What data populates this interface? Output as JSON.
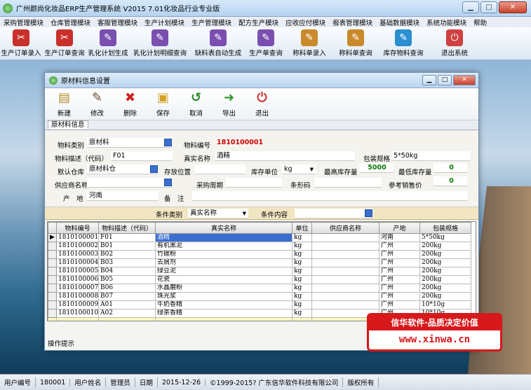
{
  "window": {
    "title": "广州颜尚化妆品ERP生产管理系统  V2015  7.01化妆品行业专业版",
    "min": "▁",
    "max": "□",
    "close": "✕"
  },
  "menu": [
    "采购管理模块",
    "仓库管理模块",
    "客服管理模块",
    "生产计划模块",
    "生产管理模块",
    "配方生产模块",
    "应收应付模块",
    "报表管理模块",
    "基础数据模块",
    "系统功能模块",
    "帮助"
  ],
  "toolbar": [
    {
      "label": "生产订单录入",
      "icon": "pdf-icon",
      "color": "#c9302c"
    },
    {
      "label": "生产订单查询",
      "icon": "pdf-icon",
      "color": "#c9302c"
    },
    {
      "label": "乳化计划生成",
      "icon": "pen-icon",
      "color": "#7a4fb0"
    },
    {
      "label": "乳化计划明细查询",
      "icon": "document-icon",
      "color": "#7a4fb0"
    },
    {
      "label": "缺料表自动生成",
      "icon": "document-icon",
      "color": "#7a4fb0"
    },
    {
      "label": "生产单查询",
      "icon": "document-icon",
      "color": "#7a4fb0"
    },
    {
      "label": "称料单录入",
      "icon": "tree-icon",
      "color": "#c98a2b"
    },
    {
      "label": "称料单查询",
      "icon": "tree-icon",
      "color": "#c98a2b"
    },
    {
      "label": "库存物料查询",
      "icon": "feather-icon",
      "color": "#2a8fd0"
    },
    {
      "label": "退出系统",
      "icon": "exit-icon",
      "color": "#d04040"
    }
  ],
  "child": {
    "title": "原材料信息设置",
    "min": "▁",
    "max": "□",
    "close": "✕"
  },
  "ctool": [
    {
      "label": "新建",
      "glyph": "▤",
      "color": "#b58a2b"
    },
    {
      "label": "修改",
      "glyph": "✎",
      "color": "#6a5030"
    },
    {
      "label": "删除",
      "glyph": "✖",
      "color": "#d02020"
    },
    {
      "label": "保存",
      "glyph": "▣",
      "color": "#d4a020"
    },
    {
      "label": "取消",
      "glyph": "↺",
      "color": "#2a8a2a"
    },
    {
      "label": "导出",
      "glyph": "➜",
      "color": "#2a9a2a"
    },
    {
      "label": "退出",
      "glyph": "⏻",
      "color": "#d03030"
    }
  ],
  "tab": "原材料信息",
  "form": {
    "type_label": "物料类别",
    "type_value": "原材料",
    "code_label": "物料编号",
    "code_value": "1810100001",
    "desc_label": "物料描述（代码）",
    "desc_value": "F01",
    "name_label": "真实名称",
    "name_value": "酒精",
    "spec_label": "包装规格",
    "spec_value": "5*50kg",
    "wh_label": "默认仓库",
    "wh_value": "原材料仓",
    "loc_label": "存放位置",
    "loc_value": "",
    "unit_label": "库存单位",
    "unit_value": "kg",
    "max_label": "最高库存量",
    "max_value": "5000",
    "min_label": "最低库存量",
    "min_value": "0",
    "supplier_label": "供应商名称",
    "supplier_value": "",
    "cycle_label": "采购周期",
    "cycle_value": "",
    "barcode_label": "条形码",
    "barcode_value": "",
    "price_label": "参考销售价",
    "price_value": "0",
    "origin_label": "产　地",
    "origin_value": "河南",
    "note_label": "备　注",
    "note_value": ""
  },
  "cond": {
    "type_label": "条件类别",
    "type_value": "真实名称",
    "content_label": "条件内容",
    "content_value": ""
  },
  "grid": {
    "headers": [
      "物料编号",
      "物料描述（代码）",
      "真实名称",
      "单位",
      "供应商名称",
      "产地",
      "包装规格"
    ],
    "rows": [
      [
        "1810100001",
        "F01",
        "酒精",
        "kg",
        "",
        "河南",
        "5*50kg"
      ],
      [
        "1810100002",
        "B01",
        "有机黑泥",
        "kg",
        "",
        "广州",
        "200kg"
      ],
      [
        "1810100003",
        "B02",
        "竹碳粉",
        "kg",
        "",
        "广州",
        "200kg"
      ],
      [
        "1810100004",
        "B03",
        "去屑剂",
        "kg",
        "",
        "广州",
        "200kg"
      ],
      [
        "1810100005",
        "B04",
        "绿豆泥",
        "kg",
        "",
        "广州",
        "200kg"
      ],
      [
        "1810100006",
        "B05",
        "花瓷",
        "kg",
        "",
        "广州",
        "200kg"
      ],
      [
        "1810100007",
        "B06",
        "水晶磨粉",
        "kg",
        "",
        "广州",
        "200kg"
      ],
      [
        "1810100008",
        "B07",
        "珠光浆",
        "kg",
        "",
        "广州",
        "200kg"
      ],
      [
        "1810100009",
        "A01",
        "牛奶香精",
        "kg",
        "",
        "广州",
        "10*10g"
      ],
      [
        "1810100010",
        "A02",
        "绿茶香精",
        "kg",
        "",
        "广州",
        "10*10g"
      ]
    ]
  },
  "hint": "操作提示",
  "promo": {
    "line1": "信华软件·品质决定价值",
    "line2": "www.xinwa.cn"
  },
  "status": [
    "用户编号",
    "180001",
    "用户姓名",
    "管理员",
    "日期",
    "2015-12-26",
    "©1999-2015?  广东信华软件科技有限公司",
    "版权所有"
  ]
}
